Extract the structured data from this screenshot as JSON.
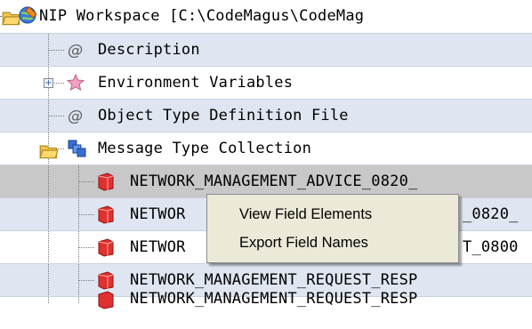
{
  "tree": {
    "root": {
      "label": "NIP Workspace [C:\\CodeMagus\\CodeMag",
      "icon": "workspace-globe-icon",
      "expander": "−"
    },
    "items": [
      {
        "label": "Description",
        "icon": "at-icon"
      },
      {
        "label": "Environment Variables",
        "icon": "star-icon",
        "expander": "+"
      },
      {
        "label": "Object Type Definition File",
        "icon": "at-icon"
      },
      {
        "label": "Message Type Collection",
        "icon": "collection-icon",
        "expander": "−"
      }
    ],
    "messages": [
      {
        "label": "NETWORK_MANAGEMENT_ADVICE_0820_",
        "icon": "message-type-icon"
      },
      {
        "label": "NETWOR",
        "tail": "_0820_",
        "icon": "message-type-icon"
      },
      {
        "label": "NETWOR",
        "tail": "T_0800",
        "icon": "message-type-icon"
      },
      {
        "label": "NETWORK_MANAGEMENT_REQUEST_RESP",
        "icon": "message-type-icon"
      },
      {
        "label": "NETWORK_MANAGEMENT_REQUEST_RESP",
        "icon": "message-type-icon"
      }
    ]
  },
  "context_menu": {
    "items": [
      {
        "label": "View Field Elements"
      },
      {
        "label": "Export Field Names"
      }
    ]
  },
  "colors": {
    "alt_row": "#dfe6f1",
    "selected_row": "#c8c8c8",
    "menu_bg": "#ece9d8"
  }
}
